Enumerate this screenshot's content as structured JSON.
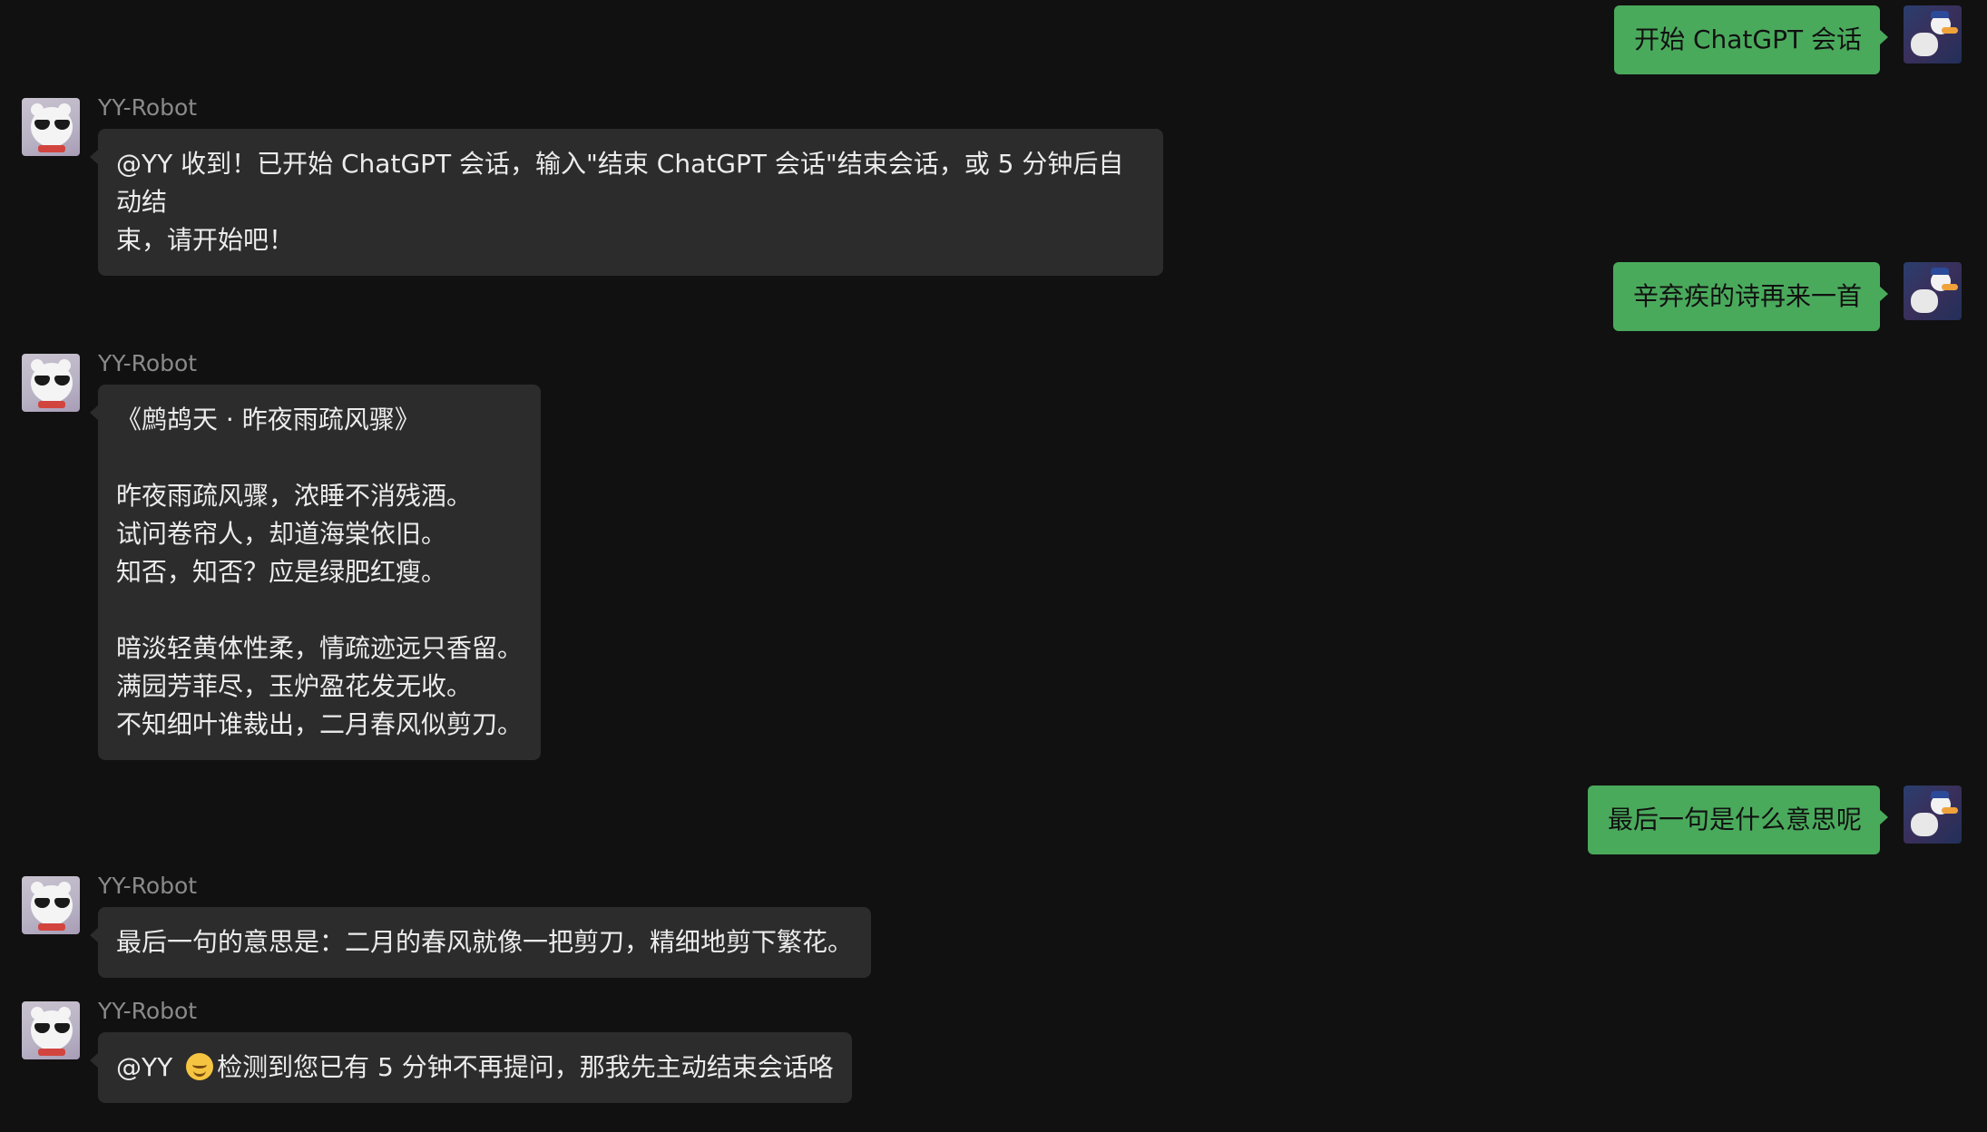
{
  "conversation": {
    "messages": [
      {
        "from": "user",
        "text": "开始 ChatGPT 会话"
      },
      {
        "from": "bot",
        "sender": "YY-Robot",
        "text": "@YY 收到！已开始 ChatGPT 会话，输入\"结束 ChatGPT 会话\"结束会话，或 5 分钟后自动结\n束，请开始吧！"
      },
      {
        "from": "user",
        "text": "辛弃疾的诗再来一首"
      },
      {
        "from": "bot",
        "sender": "YY-Robot",
        "text": "《鹧鸪天 · 昨夜雨疏风骤》\n\n昨夜雨疏风骤，浓睡不消残酒。\n试问卷帘人，却道海棠依旧。\n知否，知否？应是绿肥红瘦。\n\n暗淡轻黄体性柔，情疏迹远只香留。\n满园芳菲尽，玉炉盈花发无收。\n不知细叶谁裁出，二月春风似剪刀。"
      },
      {
        "from": "user",
        "text": "最后一句是什么意思呢"
      },
      {
        "from": "bot",
        "sender": "YY-Robot",
        "text": "最后一句的意思是：二月的春风就像一把剪刀，精细地剪下繁花。"
      },
      {
        "from": "bot",
        "sender": "YY-Robot",
        "text_before_emoji": "@YY ",
        "emoji": "smiling-face-emoji",
        "text_after_emoji": "检测到您已有 5 分钟不再提问，那我先主动结束会话咯"
      }
    ]
  },
  "colors": {
    "background": "#111111",
    "user_bubble": "#4aaa5c",
    "bot_bubble": "#2c2c2c",
    "sender_name": "#8a8a8a"
  }
}
